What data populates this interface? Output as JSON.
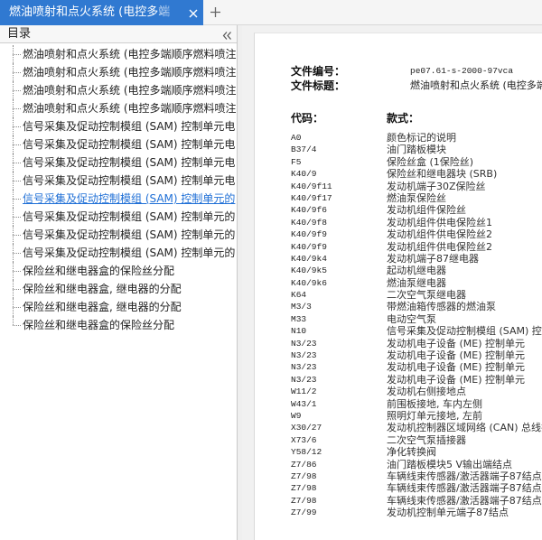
{
  "colors": {
    "tab_active": "#3079d1",
    "selected_link": "#1f6fd6",
    "tree_line": "#8a8a8a"
  },
  "tab_bar": {
    "tabs": [
      {
        "label": "燃油喷射和点火系统 (电控多端",
        "active": true
      }
    ],
    "close_icon": "close-icon",
    "new_tab_icon": "plus-icon"
  },
  "sidebar": {
    "title": "目录",
    "collapse_icon": "double-chevron-left-icon",
    "items": [
      {
        "label": "燃油喷射和点火系统 (电控多端顺序燃料喷注"
      },
      {
        "label": "燃油喷射和点火系统 (电控多端顺序燃料喷注"
      },
      {
        "label": "燃油喷射和点火系统 (电控多端顺序燃料喷注"
      },
      {
        "label": "燃油喷射和点火系统 (电控多端顺序燃料喷注"
      },
      {
        "label": "信号采集及促动控制模组 (SAM) 控制单元电"
      },
      {
        "label": "信号采集及促动控制模组 (SAM) 控制单元电"
      },
      {
        "label": "信号采集及促动控制模组 (SAM) 控制单元电"
      },
      {
        "label": "信号采集及促动控制模组 (SAM) 控制单元电"
      },
      {
        "label": "信号采集及促动控制模组 (SAM) 控制单元的",
        "selected": true
      },
      {
        "label": "信号采集及促动控制模组 (SAM) 控制单元的"
      },
      {
        "label": "信号采集及促动控制模组 (SAM) 控制单元的"
      },
      {
        "label": "信号采集及促动控制模组 (SAM) 控制单元的"
      },
      {
        "label": "保险丝和继电器盒的保险丝分配"
      },
      {
        "label": "保险丝和继电器盒, 继电器的分配"
      },
      {
        "label": "保险丝和继电器盒, 继电器的分配"
      },
      {
        "label": "保险丝和继电器盒的保险丝分配"
      }
    ]
  },
  "document": {
    "file_number_label": "文件编号：",
    "file_number": "pe07.61-s-2000-97vca",
    "file_title_label": "文件标题：",
    "file_title": "燃油喷射和点火系统 (电控多端",
    "code_header": "代码：",
    "model_header": "款式：",
    "rows": [
      {
        "code": "A0",
        "desc": "颜色标记的说明"
      },
      {
        "code": "B37/4",
        "desc": "油门踏板模块"
      },
      {
        "code": "F5",
        "desc": "保险丝盒 (1保险丝)"
      },
      {
        "code": "K40/9",
        "desc": "保险丝和继电器块 (SRB)"
      },
      {
        "code": "K40/9f11",
        "desc": "发动机端子30Z保险丝"
      },
      {
        "code": "K40/9f17",
        "desc": "燃油泵保险丝"
      },
      {
        "code": "K40/9f6",
        "desc": "发动机组件保险丝"
      },
      {
        "code": "K40/9f8",
        "desc": "发动机组件供电保险丝1"
      },
      {
        "code": "K40/9f9",
        "desc": "发动机组件供电保险丝2"
      },
      {
        "code": "K40/9f9",
        "desc": "发动机组件供电保险丝2"
      },
      {
        "code": "K40/9k4",
        "desc": "发动机端子87继电器"
      },
      {
        "code": "K40/9k5",
        "desc": "起动机继电器"
      },
      {
        "code": "K40/9k6",
        "desc": "燃油泵继电器"
      },
      {
        "code": "K64",
        "desc": "二次空气泵继电器"
      },
      {
        "code": "M3/3",
        "desc": "带燃油箱传感器的燃油泵"
      },
      {
        "code": "M33",
        "desc": "电动空气泵"
      },
      {
        "code": "N10",
        "desc": "信号采集及促动控制模组 (SAM) 控制"
      },
      {
        "code": "N3/23",
        "desc": "发动机电子设备 (ME) 控制单元"
      },
      {
        "code": "N3/23",
        "desc": "发动机电子设备 (ME) 控制单元"
      },
      {
        "code": "N3/23",
        "desc": "发动机电子设备 (ME) 控制单元"
      },
      {
        "code": "N3/23",
        "desc": "发动机电子设备 (ME) 控制单元"
      },
      {
        "code": "W11/2",
        "desc": "发动机右侧接地点"
      },
      {
        "code": "W43/1",
        "desc": "前围板接地, 车内左侧"
      },
      {
        "code": "W9",
        "desc": "照明灯单元接地, 左前"
      },
      {
        "code": "X30/27",
        "desc": "发动机控制器区域网络 (CAN) 总线插"
      },
      {
        "code": "X73/6",
        "desc": "二次空气泵插接器"
      },
      {
        "code": "Y58/12",
        "desc": "净化转换阀"
      },
      {
        "code": "Z7/86",
        "desc": "油门踏板模块5 V输出端结点"
      },
      {
        "code": "Z7/98",
        "desc": "车辆线束传感器/激活器端子87结点"
      },
      {
        "code": "Z7/98",
        "desc": "车辆线束传感器/激活器端子87结点"
      },
      {
        "code": "Z7/98",
        "desc": "车辆线束传感器/激活器端子87结点"
      },
      {
        "code": "Z7/99",
        "desc": "发动机控制单元端子87结点"
      }
    ]
  }
}
